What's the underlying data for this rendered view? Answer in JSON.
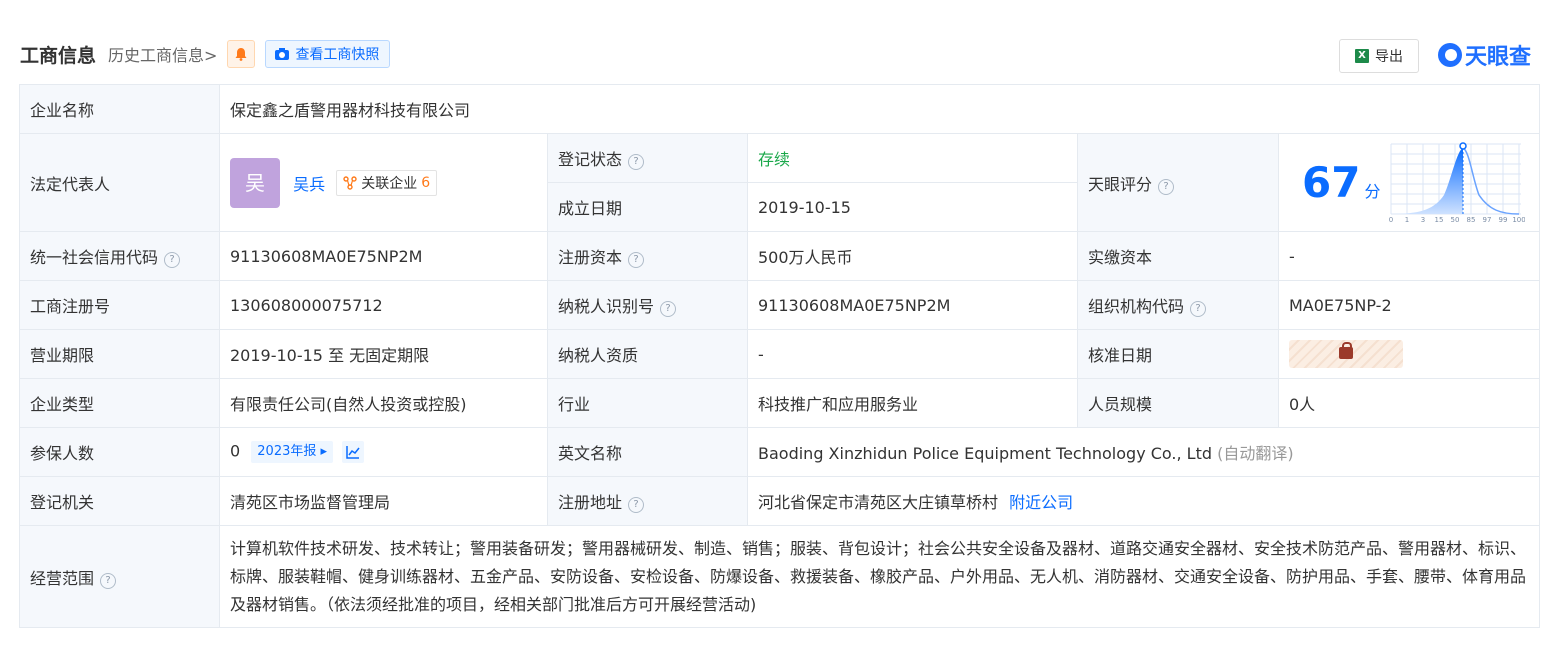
{
  "header": {
    "title": "工商信息",
    "history_link": "历史工商信息>",
    "snapshot_button": "查看工商快照",
    "export_button": "导出",
    "logo_text": "天眼查",
    "accent_color": "#0a6cff"
  },
  "company": {
    "name_label": "企业名称",
    "name_value": "保定鑫之盾警用器材科技有限公司",
    "legal_rep_label": "法定代表人",
    "legal_rep_avatar": "吴",
    "legal_rep_name": "吴兵",
    "related_label": "关联企业",
    "related_count": "6",
    "reg_status_label": "登记状态",
    "reg_status_value": "存续",
    "found_date_label": "成立日期",
    "found_date_value": "2019-10-15",
    "tianyan_score_label": "天眼评分",
    "tianyan_score_value": "67",
    "tianyan_score_unit": "分",
    "credit_code_label": "统一社会信用代码",
    "credit_code_value": "91130608MA0E75NP2M",
    "reg_capital_label": "注册资本",
    "reg_capital_value": "500万人民币",
    "paid_capital_label": "实缴资本",
    "paid_capital_value": "-",
    "reg_no_label": "工商注册号",
    "reg_no_value": "130608000075712",
    "taxpayer_id_label": "纳税人识别号",
    "taxpayer_id_value": "91130608MA0E75NP2M",
    "org_code_label": "组织机构代码",
    "org_code_value": "MA0E75NP-2",
    "term_label": "营业期限",
    "term_value": "2019-10-15 至 无固定期限",
    "taxpayer_qual_label": "纳税人资质",
    "taxpayer_qual_value": "-",
    "approve_date_label": "核准日期",
    "type_label": "企业类型",
    "type_value": "有限责任公司(自然人投资或控股)",
    "industry_label": "行业",
    "industry_value": "科技推广和应用服务业",
    "staff_label": "人员规模",
    "staff_value": "0人",
    "insured_label": "参保人数",
    "insured_value": "0",
    "insured_year": "2023年报",
    "english_name_label": "英文名称",
    "english_name_value": "Baoding Xinzhidun Police Equipment Technology Co., Ltd",
    "english_name_note": "(自动翻译)",
    "authority_label": "登记机关",
    "authority_value": "清苑区市场监督管理局",
    "address_label": "注册地址",
    "address_value": "河北省保定市清苑区大庄镇草桥村",
    "nearby_link": "附近公司",
    "scope_label": "经营范围",
    "scope_value": "计算机软件技术研发、技术转让；警用装备研发；警用器械研发、制造、销售；服装、背包设计；社会公共安全设备及器材、道路交通安全器材、安全技术防范产品、警用器材、标识、标牌、服装鞋帽、健身训练器材、五金产品、安防设备、安检设备、防爆设备、救援装备、橡胶产品、户外用品、无人机、消防器材、交通安全设备、防护用品、手套、腰带、体育用品及器材销售。（依法须经批准的项目，经相关部门批准后方可开展经营活动)"
  },
  "score_chart": {
    "x_ticks": [
      "0",
      "1",
      "3",
      "15",
      "50",
      "85",
      "97",
      "99",
      "100"
    ]
  }
}
